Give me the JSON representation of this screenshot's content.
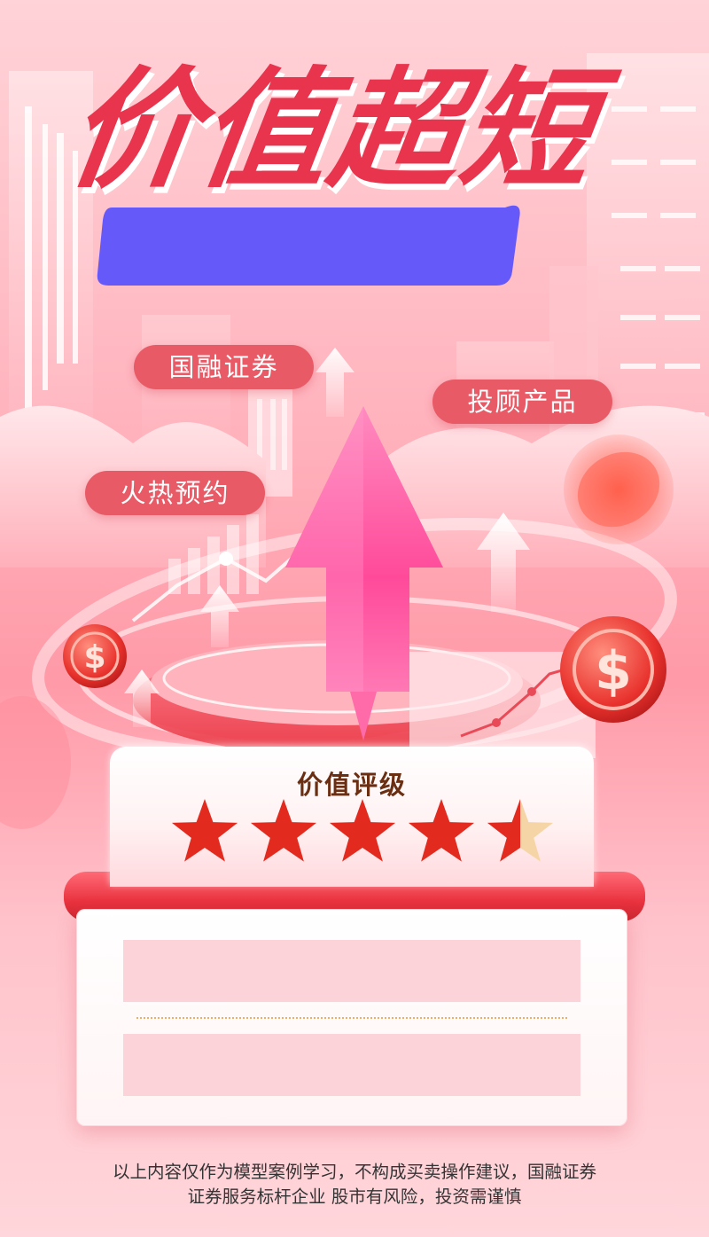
{
  "poster": {
    "headline": "价值超短",
    "tags": [
      "国融证券",
      "投顾产品",
      "火热预约"
    ],
    "rating": {
      "title": "价值评级",
      "stars": 4.5,
      "max_stars": 5
    },
    "disclaimer": {
      "line1": "以上内容仅作为模型案例学习，不构成买卖操作建议，国融证券",
      "line2": "证券服务标杆企业  股市有风险，投资需谨慎"
    }
  },
  "colors": {
    "headline": "#e8344c",
    "accent_bar": "#6659fa",
    "tag_pill": "#e85a66",
    "star_filled": "#e22a1e",
    "star_empty": "#f5d5a6",
    "rating_title": "#6a2e12",
    "base_bar": "#e9333f"
  },
  "icons": [
    "dollar-coin-icon",
    "up-arrow-icon",
    "star-icon"
  ]
}
